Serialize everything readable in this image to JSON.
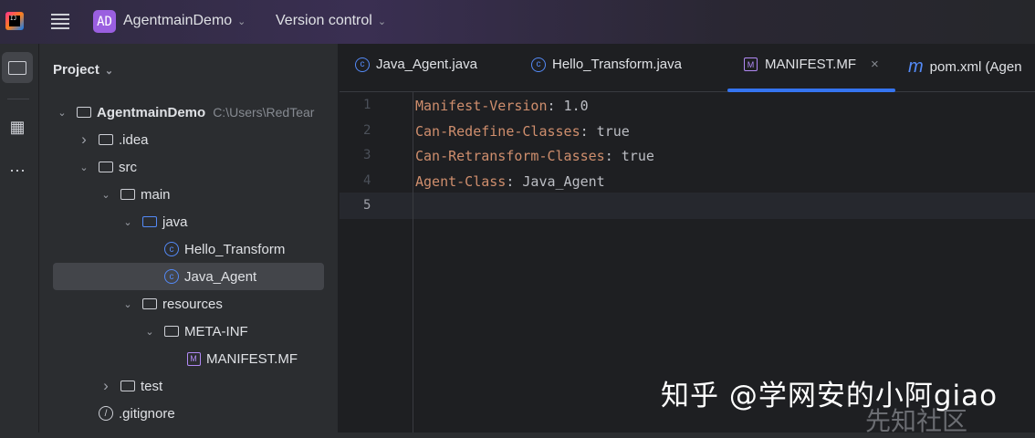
{
  "topbar": {
    "project_badge": "AD",
    "project_name": "AgentmainDemo",
    "vcs": "Version control",
    "logo_text": "IJ"
  },
  "panel": {
    "title": "Project",
    "tree": [
      {
        "label": "AgentmainDemo",
        "path": "C:\\Users\\RedTear",
        "icon": "module-folder-icon",
        "expanded": true
      },
      {
        "label": ".idea",
        "icon": "folder-icon",
        "expanded": false
      },
      {
        "label": "src",
        "icon": "folder-icon",
        "expanded": true
      },
      {
        "label": "main",
        "icon": "folder-icon",
        "expanded": true
      },
      {
        "label": "java",
        "icon": "source-folder-icon",
        "expanded": true
      },
      {
        "label": "Hello_Transform",
        "icon": "class-icon"
      },
      {
        "label": "Java_Agent",
        "icon": "class-icon",
        "selected": true
      },
      {
        "label": "resources",
        "icon": "resources-folder-icon",
        "expanded": true
      },
      {
        "label": "META-INF",
        "icon": "folder-icon",
        "expanded": true
      },
      {
        "label": "MANIFEST.MF",
        "icon": "manifest-icon"
      },
      {
        "label": "test",
        "icon": "folder-icon",
        "expanded": false
      },
      {
        "label": ".gitignore",
        "icon": "ignore-file-icon"
      }
    ]
  },
  "editor": {
    "tabs": [
      {
        "label": "Java_Agent.java"
      },
      {
        "label": "Hello_Transform.java"
      },
      {
        "label": "MANIFEST.MF",
        "active": true
      },
      {
        "label": "pom.xml (Agen"
      }
    ],
    "lines": [
      {
        "n": "1",
        "key": "Manifest-Version",
        "value": ": 1.0"
      },
      {
        "n": "2",
        "key": "Can-Redefine-Classes",
        "value": ": true"
      },
      {
        "n": "3",
        "key": "Can-Retransform-Classes",
        "value": ": true"
      },
      {
        "n": "4",
        "key": "Agent-Class",
        "value": ": Java_Agent"
      },
      {
        "n": "5",
        "key": "",
        "value": ""
      }
    ]
  },
  "watermark": {
    "zhihu": "知乎 @学网安的小阿giao",
    "xianzhi": "先知社区"
  },
  "colors": {
    "accent": "#3574f0",
    "key": "#cf8e6d",
    "badge": "#9a5fe0"
  }
}
